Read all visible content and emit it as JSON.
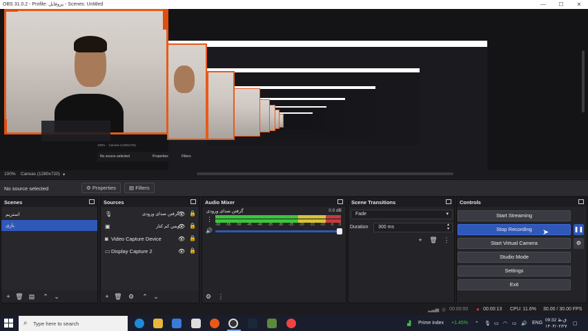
{
  "window": {
    "title": "OBS 31.0.2 - Profile: پروفایل - Scenes: Untitled",
    "minimize_glyph": "—",
    "maximize_glyph": "☐",
    "close_glyph": "✕"
  },
  "nested_preview": {
    "zoom": "100%",
    "canvas": "Canvas (1280x720)",
    "no_source": "No source selected",
    "properties": "Properties",
    "filters": "Filters"
  },
  "preview_bar": {
    "zoom": "100%",
    "canvas": "Canvas (1280x720)"
  },
  "context_bar": {
    "no_source": "No source selected",
    "properties": "Properties",
    "filters": "Filters"
  },
  "scenes": {
    "title": "Scenes",
    "items": [
      {
        "label": "استریم",
        "active": false
      },
      {
        "label": "بازی",
        "active": true
      }
    ]
  },
  "sources": {
    "title": "Sources",
    "items": [
      {
        "label": "گرفتن صدای ورودی",
        "icon": "mic-icon",
        "rtl": true
      },
      {
        "label": "ویس کم کنار",
        "icon": "image-icon",
        "rtl": true
      },
      {
        "label": "Video Capture Device",
        "icon": "camera-icon",
        "rtl": false
      },
      {
        "label": "Display Capture 2",
        "icon": "monitor-icon",
        "rtl": false
      }
    ]
  },
  "audio_mixer": {
    "title": "Audio Mixer",
    "channel_name": "گرفتن صدای ورودی",
    "level_db": "0.0 dB",
    "ticks": [
      "-60",
      "-55",
      "-50",
      "-45",
      "-40",
      "-35",
      "-30",
      "-25",
      "-20",
      "-15",
      "-10",
      "-5",
      "0"
    ],
    "volume_percent": 100
  },
  "transitions": {
    "title": "Scene Transitions",
    "transition": "Fade",
    "duration_label": "Duration",
    "duration_value": "300 ms"
  },
  "controls": {
    "title": "Controls",
    "start_streaming": "Start Streaming",
    "stop_recording": "Stop Recording",
    "start_virtual_camera": "Start Virtual Camera",
    "studio_mode": "Studio Mode",
    "settings": "Settings",
    "exit": "Exit"
  },
  "status": {
    "stream_time": "00:00:00",
    "rec_time": "00:00:13",
    "cpu": "CPU: 11.6%",
    "fps": "30.00 / 30.00 FPS"
  },
  "taskbar": {
    "search_placeholder": "Type here to search",
    "stock_name": "Prime index",
    "stock_change": "+1.45%",
    "language": "ENG",
    "time": "09:32 ق.ظ",
    "date": "۱۴۰۴/۰۲/۲۷"
  },
  "colors": {
    "accent": "#2f58b8",
    "frame_orange": "#e85a17",
    "recording_red": "#d93030",
    "meter_green": "#3cc43c"
  }
}
